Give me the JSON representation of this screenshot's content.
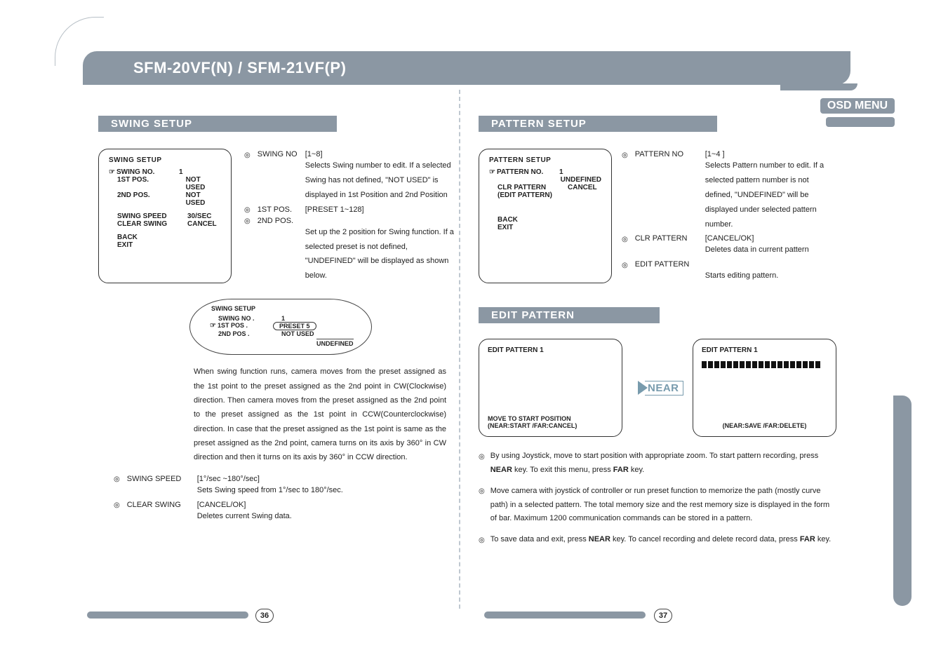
{
  "header": {
    "title": "SFM-20VF(N) / SFM-21VF(P)",
    "osd_label": "OSD MENU"
  },
  "left": {
    "section_title": "SWING SETUP",
    "menu": {
      "title": "SWING SETUP",
      "rows": [
        {
          "k": "SWING NO.",
          "v": "1",
          "pointer": true
        },
        {
          "k": "1ST POS.",
          "v": "NOT USED",
          "indent": true
        },
        {
          "k": "2ND POS.",
          "v": "NOT USED",
          "indent": true
        },
        {
          "k": "",
          "v": "",
          "spacer": true
        },
        {
          "k": "SWING SPEED",
          "v": "30/SEC",
          "indent": true
        },
        {
          "k": "CLEAR SWING",
          "v": "CANCEL",
          "indent": true
        },
        {
          "k": "",
          "v": "",
          "spacer": true
        },
        {
          "k": "BACK",
          "v": "",
          "indent": true
        },
        {
          "k": "EXIT",
          "v": "",
          "indent": true
        }
      ]
    },
    "specs": [
      {
        "key": "SWING NO",
        "range": "[1~8]",
        "desc": "Selects Swing number to edit. If a selected Swing has not defined, \"NOT USED\" is displayed in 1st Position and 2nd Position"
      },
      {
        "key": "1ST POS.",
        "range": "[PRESET 1~128]"
      },
      {
        "key": "2ND POS.",
        "range": "",
        "desc": "Set up the 2 position for Swing function. If a selected preset is not defined, \"UNDEFINED\" will be displayed as shown below."
      }
    ],
    "callout": {
      "title": "SWING SETUP",
      "rows": [
        {
          "k": "SWING NO .",
          "v": "1"
        },
        {
          "k": "1ST POS .",
          "v": "PRESET   5",
          "pointer": true,
          "pill": true
        },
        {
          "k": "2ND POS .",
          "v": "NOT USED"
        }
      ],
      "tail": "UNDEFINED"
    },
    "para": "When swing function runs, camera moves from the preset assigned as the 1st point to the preset assigned as the 2nd point in CW(Clockwise) direction. Then camera moves from the preset assigned as the 2nd point to the preset assigned as the 1st point in CCW(Counterclockwise) direction. In case that the preset assigned as the 1st point is same as the preset assigned as the 2nd point, camera turns on its axis by 360° in CW direction and then it turns on its axis by 360° in CCW direction.",
    "specs_b": [
      {
        "key": "SWING SPEED",
        "range": "[1°/sec ~180°/sec]",
        "desc": "Sets Swing speed from 1°/sec to 180°/sec."
      },
      {
        "key": "CLEAR SWING",
        "range": "[CANCEL/OK]",
        "desc": "Deletes current Swing data."
      }
    ],
    "page": "36"
  },
  "right": {
    "section_a_title": "PATTERN SETUP",
    "menu_a": {
      "title": "PATTERN SETUP",
      "rows": [
        {
          "k": "PATTERN NO.",
          "v": "1",
          "pointer": true
        },
        {
          "k": "",
          "v": "UNDEFINED",
          "indent": true
        },
        {
          "k": "CLR PATTERN",
          "v": "CANCEL",
          "indent": true
        },
        {
          "k": "(EDIT PATTERN)",
          "v": "",
          "indent": true
        },
        {
          "k": "",
          "v": "",
          "spacer": true
        },
        {
          "k": "",
          "v": "",
          "spacer": true
        },
        {
          "k": "",
          "v": "",
          "spacer": true
        },
        {
          "k": "BACK",
          "v": "",
          "indent": true
        },
        {
          "k": "EXIT",
          "v": "",
          "indent": true
        }
      ]
    },
    "specs_a": [
      {
        "key": "PATTERN NO",
        "range": "[1~4 ]",
        "desc": "Selects Pattern number to edit. If a selected   pattern number is not defined, \"UNDEFINED\" will be displayed under selected pattern number."
      },
      {
        "key": "CLR PATTERN",
        "range": "[CANCEL/OK]",
        "desc": "Deletes data in current pattern"
      },
      {
        "key": "EDIT PATTERN",
        "range": "",
        "desc": "Starts editing pattern."
      }
    ],
    "section_b_title": "EDIT PATTERN",
    "edit_left": {
      "title": "EDIT PATTERN 1",
      "foot1": "MOVE TO START POSITION",
      "foot2": "(NEAR:START  /FAR:CANCEL)"
    },
    "edit_arrow": "NEAR",
    "edit_right": {
      "title": "EDIT PATTERN 1",
      "foot": "(NEAR:SAVE     /FAR:DELETE)"
    },
    "bullets_b": [
      "By using Joystick, move to start position with appropriate zoom. To start pattern recording, press <b>NEAR</b> key. To exit this menu, press <b>FAR</b> key.",
      "Move camera with joystick of controller or run preset function to memorize the path (mostly curve path) in a selected pattern. The total memory size and the rest memory size is displayed in the form of bar. Maximum 1200 communication commands can be stored in a pattern.",
      "To save data and exit, press <b>NEAR</b> key. To cancel recording and delete record data, press <b>FAR</b> key."
    ],
    "page": "37"
  }
}
